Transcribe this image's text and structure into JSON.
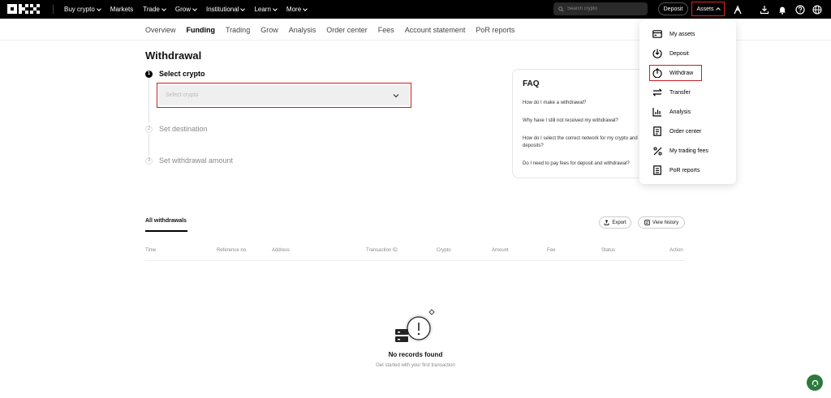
{
  "topbar": {
    "nav": [
      {
        "label": "Buy crypto",
        "dropdown": true
      },
      {
        "label": "Markets",
        "dropdown": false
      },
      {
        "label": "Trade",
        "dropdown": true
      },
      {
        "label": "Grow",
        "dropdown": true
      },
      {
        "label": "Institutional",
        "dropdown": true
      },
      {
        "label": "Learn",
        "dropdown": true
      },
      {
        "label": "More",
        "dropdown": true
      }
    ],
    "search_placeholder": "Search crypto",
    "deposit_label": "Deposit",
    "assets_label": "Assets"
  },
  "subnav": {
    "tabs": [
      "Overview",
      "Funding",
      "Trading",
      "Grow",
      "Analysis",
      "Order center",
      "Fees",
      "Account statement",
      "PoR reports"
    ],
    "active": "Funding"
  },
  "main": {
    "title": "Withdrawal",
    "steps": [
      {
        "num": "1",
        "label": "Select crypto"
      },
      {
        "num": "2",
        "label": "Set destination"
      },
      {
        "num": "3",
        "label": "Set withdrawal amount"
      }
    ],
    "select_placeholder": "Select crypto"
  },
  "faq": {
    "title": "FAQ",
    "questions": [
      "How do I make a withdrawal?",
      "Why have I still not received my withdrawal?",
      "How do I select the correct network for my crypto and deposits?",
      "Do I need to pay fees for deposit and withdrawal?"
    ]
  },
  "assets_menu": {
    "items": [
      {
        "label": "My assets",
        "icon": "wallet-icon"
      },
      {
        "label": "Deposit",
        "icon": "deposit-icon"
      },
      {
        "label": "Withdraw",
        "icon": "withdraw-icon"
      },
      {
        "label": "Transfer",
        "icon": "transfer-icon"
      },
      {
        "label": "Analysis",
        "icon": "analysis-icon"
      },
      {
        "label": "Order center",
        "icon": "order-center-icon"
      },
      {
        "label": "My trading fees",
        "icon": "percent-icon"
      },
      {
        "label": "PoR reports",
        "icon": "report-icon"
      }
    ]
  },
  "history": {
    "tab_label": "All withdrawals",
    "export_label": "Export",
    "view_history_label": "View history",
    "columns": [
      "Time",
      "Reference no.",
      "Address",
      "Transaction ID",
      "Crypto",
      "Amount",
      "Fee",
      "Status",
      "Action"
    ],
    "empty_title": "No records found",
    "empty_subtitle": "Get started with your first transaction"
  },
  "colors": {
    "highlight": "#c81e28",
    "chat": "#2c7a3c"
  }
}
